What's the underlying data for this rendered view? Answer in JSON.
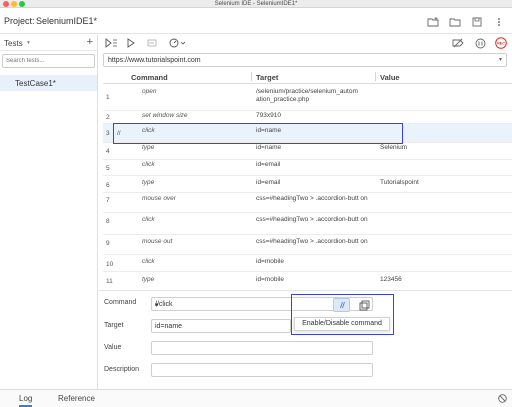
{
  "window": {
    "title": "Selenium IDE - SeleniumIDE1*"
  },
  "project": {
    "label": "Project:",
    "name": "SeleniumIDE1*"
  },
  "sidebar": {
    "tests_label": "Tests",
    "add_label": "+",
    "search_placeholder": "Search tests...",
    "test_cases": [
      "TestCase1*"
    ]
  },
  "url": {
    "value": "https://www.tutorialspoint.com"
  },
  "table": {
    "headers": {
      "command": "Command",
      "target": "Target",
      "value": "Value"
    },
    "rows": [
      {
        "num": "1",
        "disabled": "",
        "command": "open",
        "target": "/selenium/practice/selenium_autom ation_practice.php",
        "value": ""
      },
      {
        "num": "2",
        "disabled": "",
        "command": "set window size",
        "target": "793x910",
        "value": ""
      },
      {
        "num": "3",
        "disabled": "//",
        "command": "click",
        "target": "id=name",
        "value": ""
      },
      {
        "num": "4",
        "disabled": "",
        "command": "type",
        "target": "id=name",
        "value": "Selenium"
      },
      {
        "num": "5",
        "disabled": "",
        "command": "click",
        "target": "id=email",
        "value": ""
      },
      {
        "num": "6",
        "disabled": "",
        "command": "type",
        "target": "id=email",
        "value": "Tutorialspoint"
      },
      {
        "num": "7",
        "disabled": "",
        "command": "mouse over",
        "target": "css=#headingTwo > .accordion-butt on",
        "value": ""
      },
      {
        "num": "8",
        "disabled": "",
        "command": "click",
        "target": "css=#headingTwo > .accordion-butt on",
        "value": ""
      },
      {
        "num": "9",
        "disabled": "",
        "command": "mouse out",
        "target": "css=#headingTwo > .accordion-butt on",
        "value": ""
      },
      {
        "num": "10",
        "disabled": "",
        "command": "click",
        "target": "id=mobile",
        "value": ""
      },
      {
        "num": "11",
        "disabled": "",
        "command": "type",
        "target": "id=mobile",
        "value": "123456"
      }
    ]
  },
  "editor": {
    "command_label": "Command",
    "command_value": "//click",
    "target_label": "Target",
    "target_value": "id=name",
    "value_label": "Value",
    "value_value": "",
    "description_label": "Description",
    "description_value": "",
    "toggle_tooltip": "Enable/Disable command"
  },
  "bottom_tabs": {
    "log": "Log",
    "reference": "Reference"
  },
  "colors": {
    "highlight": "#3b42d4",
    "selected_row": "#eaf2fc",
    "rec": "#d93025"
  }
}
